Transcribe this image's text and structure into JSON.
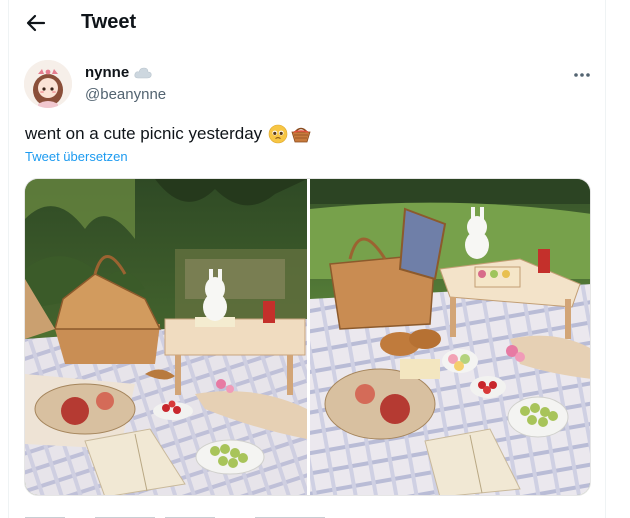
{
  "header": {
    "title": "Tweet",
    "back_icon": "arrow-left-icon"
  },
  "author": {
    "display_name": "nynne",
    "name_emoji": "cloud-icon",
    "handle": "@beanynne",
    "avatar_icon": "anime-girl-avatar"
  },
  "tweet": {
    "text": "went on a cute picnic yesterday",
    "emojis": [
      "pleading-face-icon",
      "basket-icon"
    ],
    "translate_label": "Tweet übersetzen"
  },
  "media": {
    "photos": [
      {
        "description_icon": "picnic-photo-left"
      },
      {
        "description_icon": "picnic-photo-right"
      }
    ]
  },
  "colors": {
    "link": "#1d9bf0",
    "muted": "#536471",
    "text": "#0f1419"
  }
}
